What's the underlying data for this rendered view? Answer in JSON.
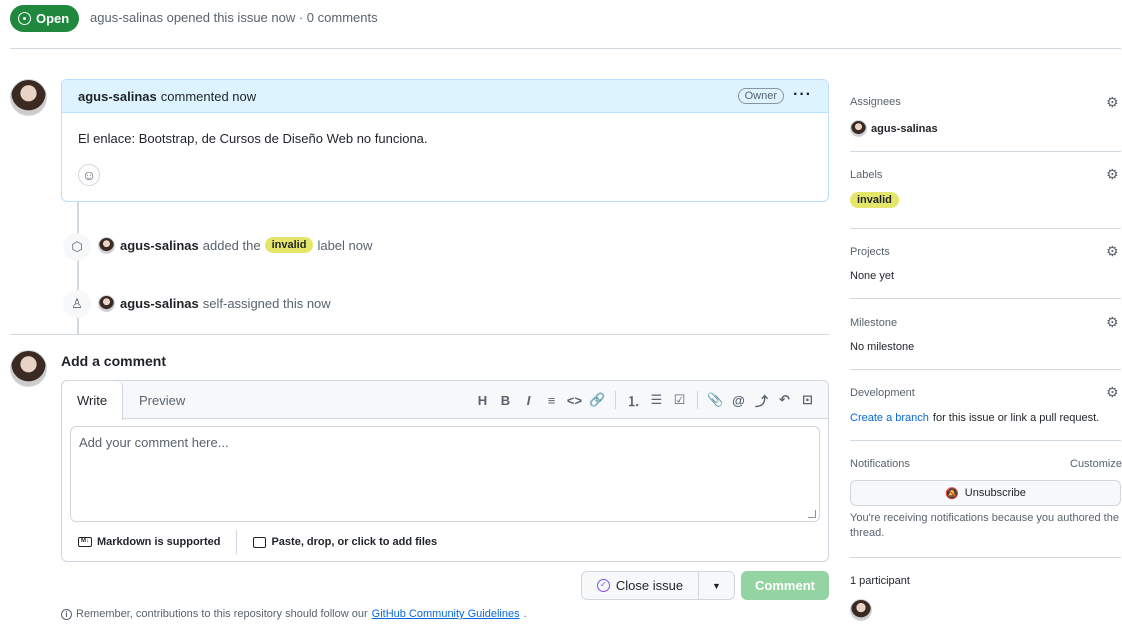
{
  "header": {
    "state": "Open",
    "author": "agus-salinas",
    "meta": "agus-salinas opened this issue now · 0 comments"
  },
  "comment": {
    "author": "agus-salinas",
    "action": "commented now",
    "role": "Owner",
    "more": "···",
    "body": "El enlace: Bootstrap, de Cursos de Diseño Web no funciona."
  },
  "timeline": [
    {
      "actor": "agus-salinas",
      "pre": "added the",
      "label": "invalid",
      "post": "label now"
    },
    {
      "actor": "agus-salinas",
      "text": "self-assigned this now"
    }
  ],
  "composer": {
    "title": "Add a comment",
    "tabs": [
      "Write",
      "Preview"
    ],
    "placeholder": "Add your comment here...",
    "markdown": "Markdown is supported",
    "attach": "Paste, drop, or click to add files",
    "toolbar": {
      "heading": "H",
      "bold": "B",
      "italic": "I",
      "quote": "≡",
      "code": "<>",
      "link": "🔗",
      "ordered": "⒈",
      "unordered": "☰",
      "tasks": "☑",
      "attach": "📎",
      "mention": "@",
      "reference": "⤴",
      "undo": "↶",
      "fullscreen": "⊡"
    },
    "close_issue": "Close issue",
    "dropdown": "▼",
    "comment_button": "Comment",
    "reminder_pre": "Remember, contributions to this repository should follow our",
    "reminder_link": "GitHub Community Guidelines",
    "reminder_post": "."
  },
  "sidebar": {
    "assignees": {
      "title": "Assignees",
      "value": "agus-salinas"
    },
    "labels": {
      "title": "Labels",
      "value": "invalid"
    },
    "projects": {
      "title": "Projects",
      "value": "None yet"
    },
    "milestone": {
      "title": "Milestone",
      "value": "No milestone"
    },
    "development": {
      "title": "Development",
      "link": "Create a branch",
      "rest": "for this issue or link a pull request."
    },
    "notifications": {
      "title": "Notifications",
      "customize": "Customize",
      "button": "Unsubscribe",
      "note": "You're receiving notifications because you authored the thread."
    },
    "participants": {
      "title": "1 participant"
    }
  },
  "colors": {
    "open_green": "#1f883d",
    "label_invalid": "#e4e669",
    "link": "#0969da",
    "comment_header": "#ddf4ff"
  },
  "icons": {
    "gear": "gear-icon",
    "tag": "tag-icon",
    "person": "person-icon",
    "smiley": "smiley-icon",
    "bell_slash": "bell-slash-icon"
  }
}
